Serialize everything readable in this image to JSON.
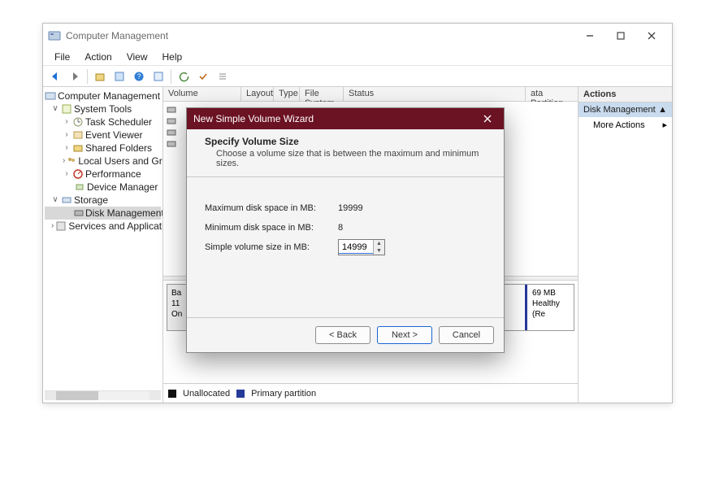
{
  "window": {
    "title": "Computer Management"
  },
  "menu": {
    "file": "File",
    "action": "Action",
    "view": "View",
    "help": "Help"
  },
  "tree": {
    "root": "Computer Management (Local)",
    "system_tools": "System Tools",
    "task_scheduler": "Task Scheduler",
    "event_viewer": "Event Viewer",
    "shared_folders": "Shared Folders",
    "local_users": "Local Users and Groups",
    "performance": "Performance",
    "device_manager": "Device Manager",
    "storage": "Storage",
    "disk_management": "Disk Management",
    "services_apps": "Services and Applications"
  },
  "columns": {
    "volume": "Volume",
    "layout": "Layout",
    "type": "Type",
    "file_system": "File System",
    "status": "Status",
    "extra": "ata Partition"
  },
  "visible_disk": {
    "prefix1": "Ba",
    "prefix2": "11",
    "prefix3": "On",
    "size": "69 MB",
    "status": "Healthy (Re"
  },
  "legend": {
    "unallocated": "Unallocated",
    "primary": "Primary partition"
  },
  "actions": {
    "header": "Actions",
    "selected": "Disk Management",
    "more": "More Actions"
  },
  "wizard": {
    "title": "New Simple Volume Wizard",
    "heading": "Specify Volume Size",
    "subheading": "Choose a volume size that is between the maximum and minimum sizes.",
    "max_label": "Maximum disk space in MB:",
    "max_value": "19999",
    "min_label": "Minimum disk space in MB:",
    "min_value": "8",
    "size_label": "Simple volume size in MB:",
    "size_value": "14999",
    "back": "< Back",
    "next": "Next >",
    "cancel": "Cancel"
  }
}
